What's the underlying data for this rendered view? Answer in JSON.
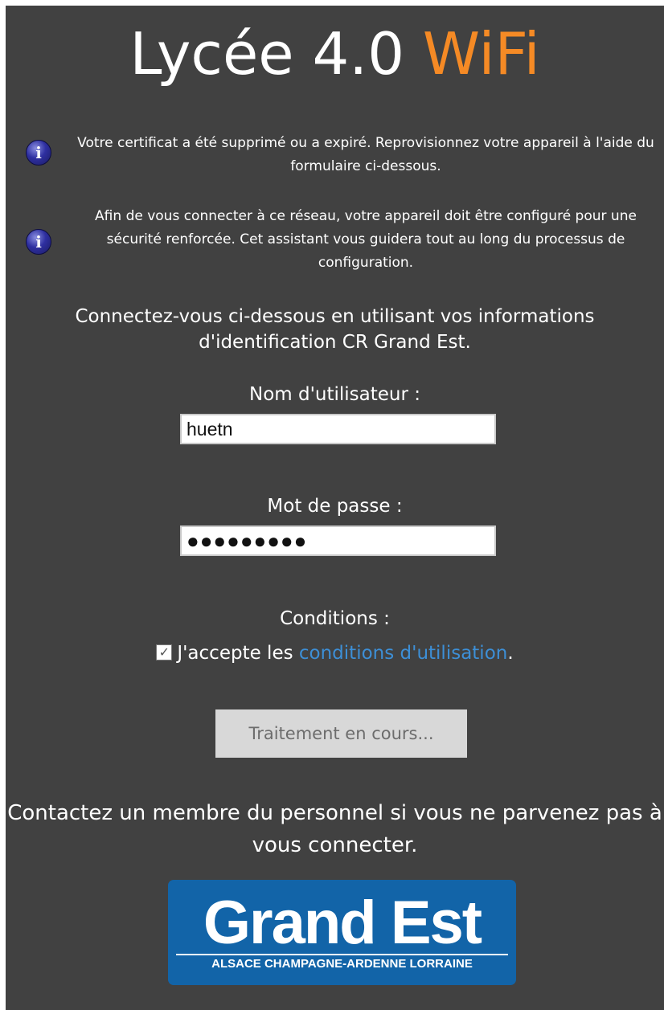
{
  "title": {
    "main": "Lycée 4.0",
    "accent": "WiFi"
  },
  "colors": {
    "background": "#414141",
    "accent": "#f58a25",
    "link": "#3d8fd6",
    "logo_bg": "#1264a8"
  },
  "notices": [
    {
      "icon": "info-icon",
      "text": "Votre certificat a été supprimé ou a expiré. Reprovisionnez votre appareil à l'aide du formulaire ci-dessous."
    },
    {
      "icon": "info-icon",
      "text": "Afin de vous connecter à ce réseau, votre appareil doit être configuré pour une sécurité renforcée. Cet assistant vous guidera tout au long du processus de configuration."
    }
  ],
  "login": {
    "lead": "Connectez-vous ci-dessous en utilisant vos informations d'identification CR Grand Est.",
    "username_label": "Nom d'utilisateur :",
    "username_value": "huetn",
    "password_label": "Mot de passe :",
    "password_value": "●●●●●●●●●"
  },
  "terms": {
    "label": "Conditions :",
    "checked": true,
    "prefix": "J'accepte les ",
    "link_text": "conditions d'utilisation",
    "suffix": "."
  },
  "submit_label": "Traitement en cours...",
  "contact": "Contactez un membre du personnel si vous ne parvenez pas à vous connecter.",
  "logo": {
    "wordmark": "Grand Est",
    "tagline": "ALSACE CHAMPAGNE-ARDENNE LORRAINE"
  }
}
